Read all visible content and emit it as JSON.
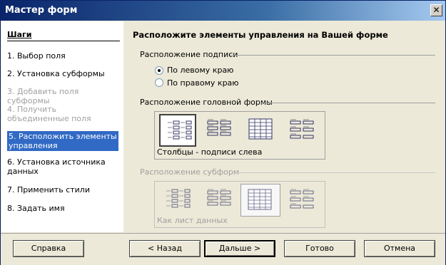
{
  "window": {
    "title": "Мастер форм",
    "close_glyph": "✕"
  },
  "sidebar": {
    "header": "Шаги",
    "steps": [
      {
        "label": "1. Выбор поля",
        "state": "normal"
      },
      {
        "label": "2. Установка субформы",
        "state": "normal"
      },
      {
        "label": "3. Добавить поля субформы",
        "state": "disabled"
      },
      {
        "label": "4. Получить объединенные поля",
        "state": "disabled"
      },
      {
        "label": "5. Расположить элементы управления",
        "state": "active"
      },
      {
        "label": "6. Установка источника данных",
        "state": "normal"
      },
      {
        "label": "7. Применить стили",
        "state": "normal"
      },
      {
        "label": "8. Задать имя",
        "state": "normal"
      }
    ]
  },
  "main": {
    "heading": "Расположите элементы управления на Вашей форме",
    "label_placement": {
      "title": "Расположение подписи",
      "options": [
        {
          "label": "По левому краю",
          "checked": true
        },
        {
          "label": "По правому краю",
          "checked": false
        }
      ]
    },
    "main_form_layout": {
      "title": "Расположение головной формы",
      "selected_index": 0,
      "selected_caption": "Столбцы - подписи слева",
      "icons": [
        "columns-labels-left-icon",
        "columns-labels-above-icon",
        "datasheet-icon",
        "blocks-labels-above-icon"
      ]
    },
    "subform_layout": {
      "title": "Расположение субформ",
      "selected_index": 2,
      "selected_caption": "Как лист данных",
      "icons": [
        "columns-labels-left-icon",
        "columns-labels-above-icon",
        "datasheet-icon",
        "blocks-labels-above-icon"
      ],
      "disabled": true
    }
  },
  "buttons": {
    "help": "Справка",
    "back": "< Назад",
    "next": "Дальше >",
    "finish": "Готово",
    "cancel": "Отмена"
  },
  "colors": {
    "accent": "#316ac5",
    "titlebar": "#0a246a"
  }
}
